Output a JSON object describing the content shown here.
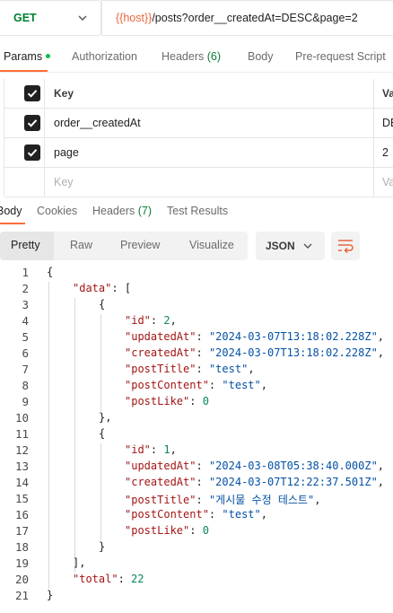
{
  "request": {
    "method": "GET",
    "url_var": "{{host}}",
    "url_path": "/posts?order__createdAt=DESC&page=2"
  },
  "request_tabs": [
    {
      "label": "Params",
      "count": "",
      "active": true,
      "dot": true
    },
    {
      "label": "Authorization",
      "count": "",
      "active": false
    },
    {
      "label": "Headers",
      "count": "(6)",
      "active": false
    },
    {
      "label": "Body",
      "count": "",
      "active": false
    },
    {
      "label": "Pre-request Script",
      "count": "",
      "active": false
    }
  ],
  "params": {
    "header_key": "Key",
    "header_value": "Va",
    "rows": [
      {
        "key": "order__createdAt",
        "value": "DE",
        "checked": true
      },
      {
        "key": "page",
        "value": "2",
        "checked": true
      }
    ],
    "placeholder_key": "Key",
    "placeholder_value": "Va"
  },
  "response_tabs": [
    {
      "label": "Body",
      "count": "",
      "active": true
    },
    {
      "label": "Cookies",
      "count": "",
      "active": false
    },
    {
      "label": "Headers",
      "count": "(7)",
      "active": false
    },
    {
      "label": "Test Results",
      "count": "",
      "active": false
    }
  ],
  "view_modes": [
    "Pretty",
    "Raw",
    "Preview",
    "Visualize"
  ],
  "format": "JSON",
  "code_lines": [
    {
      "n": "1",
      "t": "{"
    },
    {
      "n": "2",
      "t": "\"data\": ["
    },
    {
      "n": "3",
      "t": "{"
    },
    {
      "n": "4",
      "t": "\"id\": 2,"
    },
    {
      "n": "5",
      "t": "\"updatedAt\": \"2024-03-07T13:18:02.228Z\","
    },
    {
      "n": "6",
      "t": "\"createdAt\": \"2024-03-07T13:18:02.228Z\","
    },
    {
      "n": "7",
      "t": "\"postTitle\": \"test\","
    },
    {
      "n": "8",
      "t": "\"postContent\": \"test\","
    },
    {
      "n": "9",
      "t": "\"postLike\": 0"
    },
    {
      "n": "10",
      "t": "},"
    },
    {
      "n": "11",
      "t": "{"
    },
    {
      "n": "12",
      "t": "\"id\": 1,"
    },
    {
      "n": "13",
      "t": "\"updatedAt\": \"2024-03-08T05:38:40.000Z\","
    },
    {
      "n": "14",
      "t": "\"createdAt\": \"2024-03-07T12:22:37.501Z\","
    },
    {
      "n": "15",
      "t": "\"postTitle\": \"게시물 수정 테스트\","
    },
    {
      "n": "16",
      "t": "\"postContent\": \"test\","
    },
    {
      "n": "17",
      "t": "\"postLike\": 0"
    },
    {
      "n": "18",
      "t": "}"
    },
    {
      "n": "19",
      "t": "],"
    },
    {
      "n": "20",
      "t": "\"total\": 22"
    },
    {
      "n": "21",
      "t": "}"
    }
  ],
  "colors": {
    "accent": "#ff6c37",
    "method": "#007f31",
    "url_var": "#e8663d",
    "json_key": "#a31515",
    "json_string": "#0451a5",
    "json_number": "#098658"
  }
}
